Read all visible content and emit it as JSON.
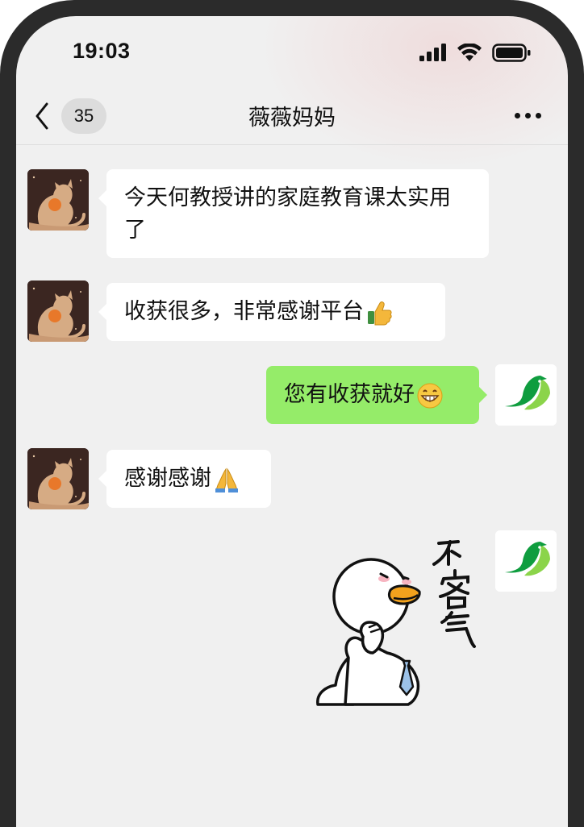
{
  "status_bar": {
    "time": "19:03"
  },
  "nav": {
    "unread_count": "35",
    "title": "薇薇妈妈"
  },
  "messages": [
    {
      "side": "left",
      "sender": "contact",
      "text": "今天何教授讲的家庭教育课太实用了"
    },
    {
      "side": "left",
      "sender": "contact",
      "text": "收获很多，非常感谢平台",
      "emoji": "thumbs-up-icon"
    },
    {
      "side": "right",
      "sender": "me",
      "text": "您有收获就好",
      "emoji": "grinning-face-icon"
    },
    {
      "side": "left",
      "sender": "contact",
      "text": "感谢感谢",
      "emoji": "folded-hands-icon"
    },
    {
      "side": "right",
      "sender": "me",
      "sticker": "duck-sticker",
      "sticker_text": "不客气"
    }
  ],
  "colors": {
    "chat_background": "#f0f0f0",
    "incoming_bubble": "#ffffff",
    "outgoing_bubble": "#95ec69",
    "frame": "#2b2b2b",
    "brand_green": "#1aad19"
  }
}
